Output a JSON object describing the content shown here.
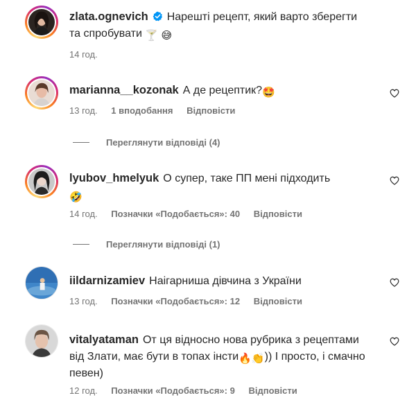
{
  "caption": {
    "username": "zlata.ognevich",
    "text": "Нарешті рецепт, який варто зберегти та спробувати",
    "emojis": [
      "🍸",
      "😅"
    ],
    "time": "14 год."
  },
  "comments": [
    {
      "username": "marianna__kozonak",
      "text": "А де рецептик?",
      "emoji_end": "🤩",
      "time": "13 год.",
      "likes": "1 вподобання",
      "reply": "Відповісти",
      "view_replies": "Переглянути відповіді (4)"
    },
    {
      "username": "lyubov_hmelyuk",
      "text": "О супер, таке ПП мені підходить",
      "emoji_end": "🤣",
      "time": "14 год.",
      "likes": "Позначки «Подобається»: 40",
      "reply": "Відповісти",
      "view_replies": "Переглянути відповіді (1)"
    },
    {
      "username": "iildarnizamiev",
      "text": "Наігарниша дівчина з України",
      "time": "13 год.",
      "likes": "Позначки «Подобається»: 12",
      "reply": "Відповісти"
    },
    {
      "username": "vitalyataman",
      "text_part1": "От ця відносно нова рубрика з рецептами від Злати, має бути в топах інсти",
      "emojis_mid": [
        "🔥",
        "👏"
      ],
      "text_part2": ")) І просто, і смачно певен)",
      "time": "12 год.",
      "likes": "Позначки «Подобається»: 9",
      "reply": "Відповісти"
    }
  ],
  "colors": {
    "text": "#262626",
    "meta": "#737373",
    "verified": "#0095f6"
  },
  "icons": {
    "like": "heart-icon",
    "verified": "verified-badge-icon"
  }
}
